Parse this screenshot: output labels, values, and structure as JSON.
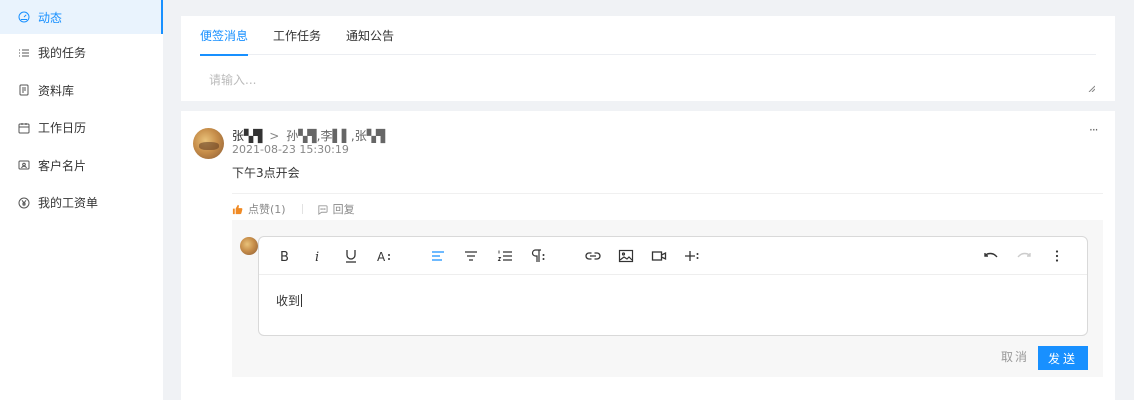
{
  "sidebar": {
    "items": [
      {
        "label": "动态",
        "icon": "dashboard-icon"
      },
      {
        "label": "我的任务",
        "icon": "list-icon"
      },
      {
        "label": "资料库",
        "icon": "document-icon"
      },
      {
        "label": "工作日历",
        "icon": "calendar-icon"
      },
      {
        "label": "客户名片",
        "icon": "contact-card-icon"
      },
      {
        "label": "我的工资单",
        "icon": "yuan-icon"
      }
    ]
  },
  "compose": {
    "tabs": [
      "便签消息",
      "工作任务",
      "通知公告"
    ],
    "placeholder": "请输入..."
  },
  "post": {
    "author": "张▚▜",
    "arrow": ">",
    "recipients": "孙▚▜,李▌▌,张▚▜",
    "time": "2021-08-23 15:30:19",
    "content": "下午3点开会",
    "like_label": "点赞(1)",
    "reply_label": "回复",
    "more": "···"
  },
  "reply": {
    "text": "收到",
    "cancel_label": "取消",
    "send_label": "发送"
  },
  "colors": {
    "accent": "#1890ff",
    "like": "#f08a24"
  }
}
